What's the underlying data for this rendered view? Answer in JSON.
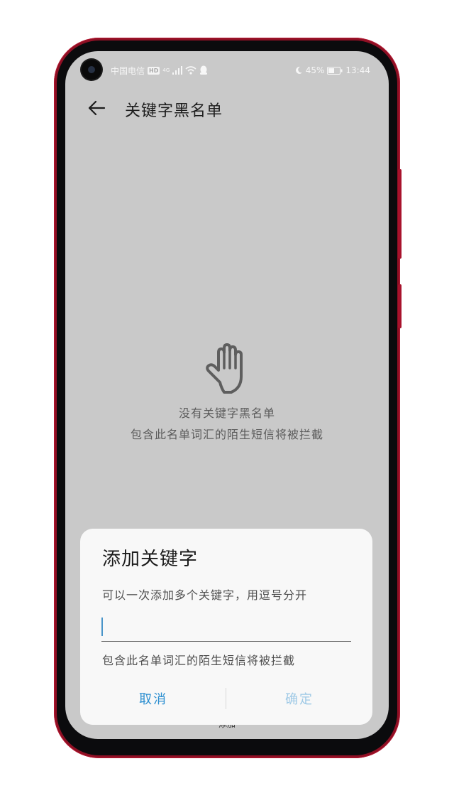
{
  "status_bar": {
    "carrier": "中国电信",
    "hd_badge": "HD",
    "network": "4G",
    "battery_percent": "45%",
    "time": "13:44"
  },
  "toolbar": {
    "title": "关键字黑名单"
  },
  "empty_state": {
    "title": "没有关键字黑名单",
    "subtitle": "包含此名单词汇的陌生短信将被拦截"
  },
  "bottom_bar": {
    "add_label": "添加"
  },
  "dialog": {
    "title": "添加关键字",
    "hint": "可以一次添加多个关键字，用逗号分开",
    "input_value": "",
    "note": "包含此名单词汇的陌生短信将被拦截",
    "cancel_label": "取消",
    "confirm_label": "确定"
  },
  "colors": {
    "screen_bg": "#c9c9c9",
    "dialog_bg": "#f8f8f8",
    "accent": "#2a8ed0",
    "accent_disabled": "#9ec9e6",
    "frame": "#8e1024"
  }
}
